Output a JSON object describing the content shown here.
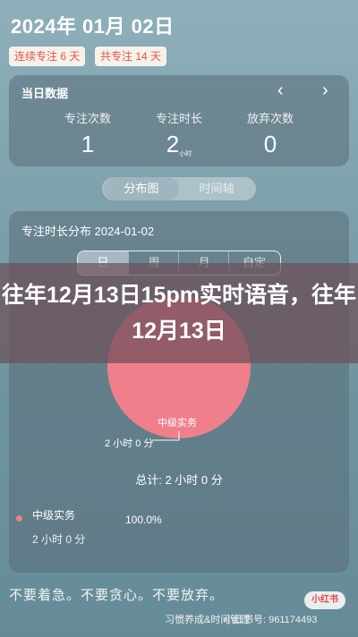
{
  "header": {
    "date": "2024年 01月 02日",
    "streak_days": "连续专注 6 天",
    "total_days": "共专注 14 天"
  },
  "day_card": {
    "title": "当日数据",
    "prev": "‹",
    "next": "›",
    "stats": [
      {
        "label": "专注次数",
        "value": "1",
        "unit": ""
      },
      {
        "label": "专注时长",
        "value": "2",
        "unit": "小时"
      },
      {
        "label": "放弃次数",
        "value": "0",
        "unit": ""
      }
    ]
  },
  "view_toggle": {
    "active": "分布图",
    "inactive": "时间轴"
  },
  "distribution": {
    "title": "专注时长分布 2024-01-02",
    "periods": [
      "日",
      "周",
      "月",
      "自定"
    ],
    "overlay_title": "往年12月13日15pm实时语音，往年12月13日",
    "slice_label": "中级实务",
    "slice_duration": "2 小时 0 分",
    "total": "总计: 2 小时 0 分",
    "legend": {
      "name": "中级实务",
      "percent": "100.0%",
      "duration": "2 小时 0 分",
      "color": "#f07f8c"
    }
  },
  "chart_data": {
    "type": "pie",
    "slices": [
      {
        "label": "中级实务",
        "value": 100.0
      }
    ]
  },
  "footer": {
    "quote": "不要着急。不要贪心。不要放弃。",
    "brand": "小红书",
    "caption": "习惯养成&时间管理",
    "id_text": "小红书号: 961174493"
  }
}
